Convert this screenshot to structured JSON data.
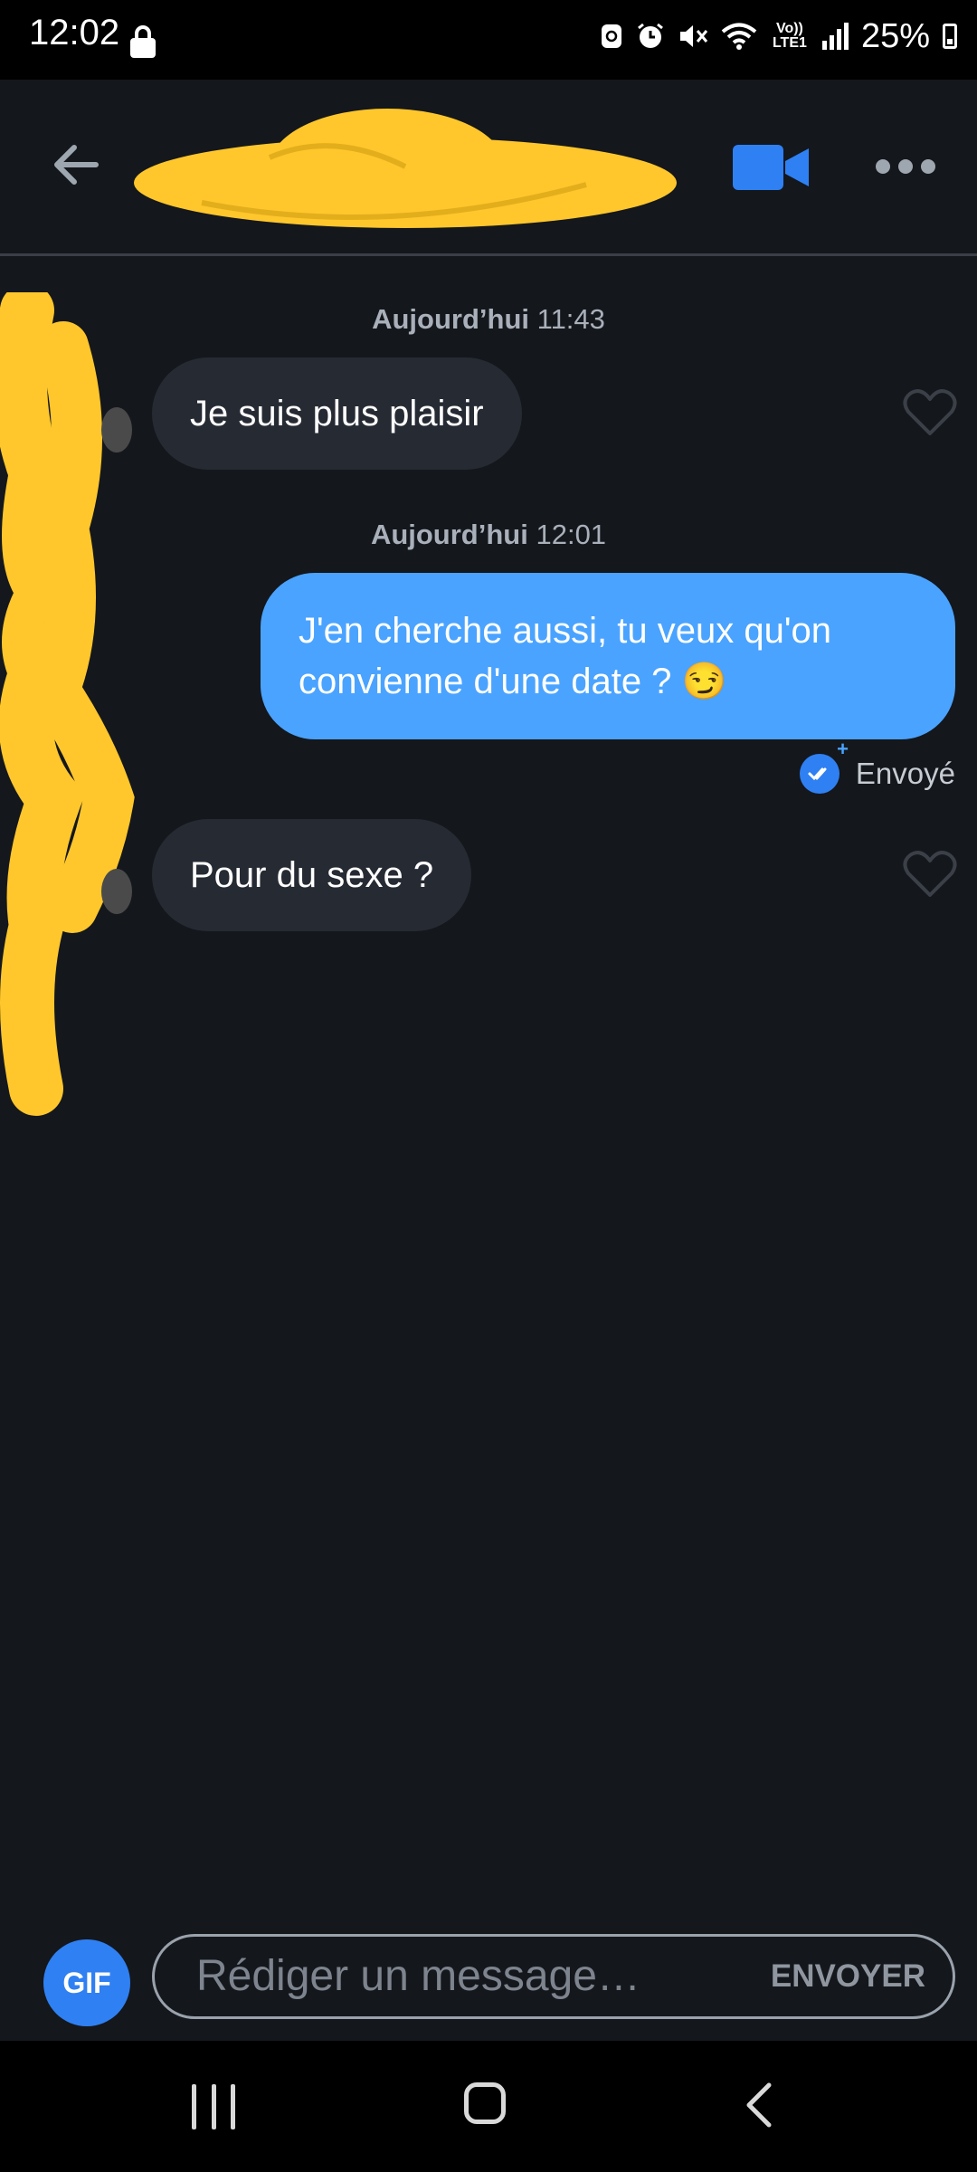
{
  "status_bar": {
    "time": "12:02",
    "network_label": "Vo)) LTE1",
    "battery_percent": "25%",
    "icons": [
      "lock-icon",
      "sync-icon",
      "alarm-icon",
      "mute-icon",
      "wifi-icon",
      "volte-icon",
      "signal-icon",
      "battery-icon"
    ]
  },
  "header": {
    "icons": [
      "back-arrow-icon",
      "video-call-icon",
      "more-options-icon"
    ],
    "accent_color": "#2f80f2"
  },
  "messages": [
    {
      "timestamp_day": "Aujourd’hui",
      "timestamp_time": "11:43",
      "direction": "incoming",
      "text": "Je suis plus plaisir"
    },
    {
      "timestamp_day": "Aujourd’hui",
      "timestamp_time": "12:01",
      "direction": "outgoing",
      "text": "J'en cherche aussi, tu veux qu'on convienne d'une date ? 😏",
      "status": "Envoyé"
    },
    {
      "direction": "incoming",
      "text": "Pour du sexe ?"
    }
  ],
  "composer": {
    "gif_label": "GIF",
    "placeholder": "Rédiger un message…",
    "send_label": "ENVOYER"
  },
  "colors": {
    "background": "#14171c",
    "incoming_bubble": "#262a33",
    "outgoing_bubble": "#4aa3ff",
    "redaction": "#ffc72c"
  },
  "nav_bar": {
    "icons": [
      "recent-apps-icon",
      "home-icon",
      "back-icon"
    ]
  }
}
